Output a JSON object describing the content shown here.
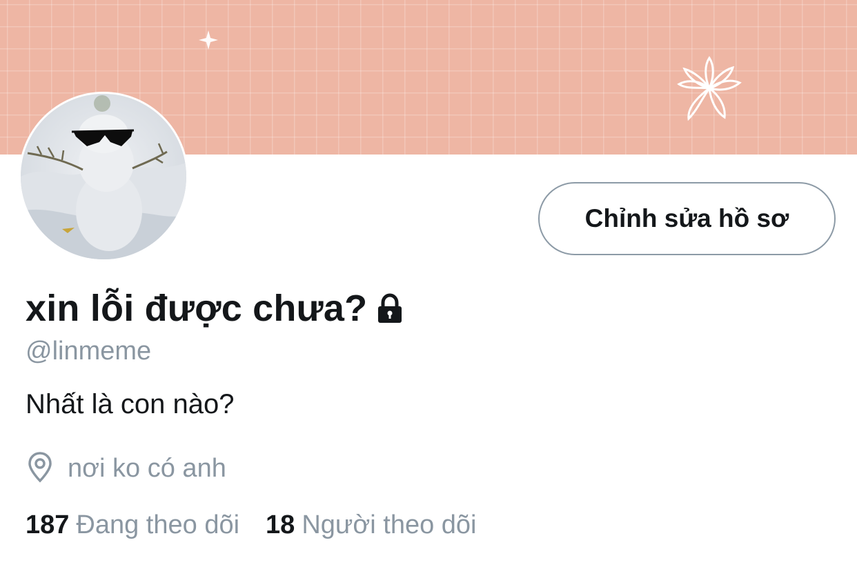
{
  "profile": {
    "display_name": "xin lỗi được chưa?",
    "handle": "@linmeme",
    "bio": "Nhất là con nào?",
    "location": "nơi ko có anh",
    "verified_lock": true
  },
  "actions": {
    "edit_profile_label": "Chỉnh sửa hồ sơ"
  },
  "stats": {
    "following_count": "187",
    "following_label": "Đang theo dõi",
    "followers_count": "18",
    "followers_label": "Người theo dõi"
  },
  "icons": {
    "lock": "lock-icon",
    "location": "location-pin-icon",
    "banner_sparkle": "sparkle-icon",
    "banner_flower": "flower-icon"
  },
  "colors": {
    "banner": "#eeb6a4",
    "text_primary": "#14171a",
    "text_secondary": "#8a96a1",
    "button_border": "#8c9aa6"
  }
}
